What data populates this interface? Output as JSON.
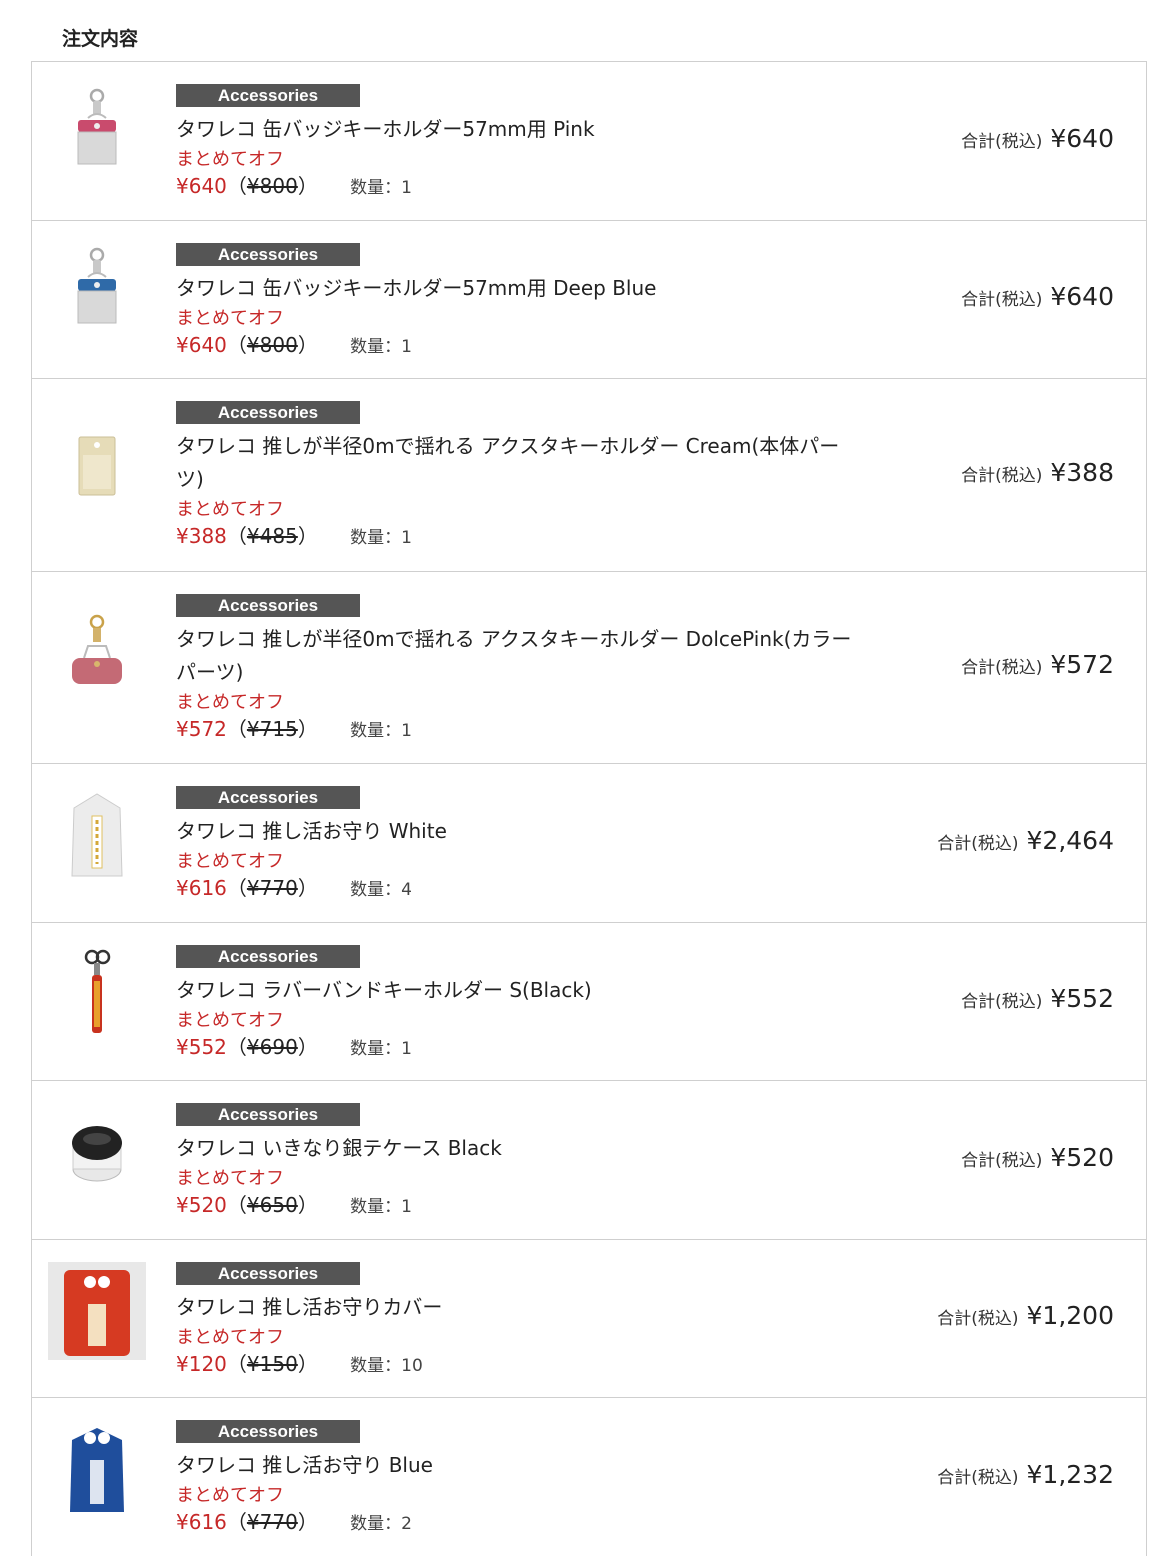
{
  "page_title": "注文内容",
  "labels": {
    "discount": "まとめてオフ",
    "qty_prefix": "数量：",
    "total_label": "合計(税込)",
    "open_paren": "（",
    "close_paren": "）"
  },
  "items": [
    {
      "category": "Accessories",
      "name": "タワレコ 缶バッジキーホルダー57mm用 Pink",
      "sale_price": "¥640",
      "original_price": "¥800",
      "quantity": "1",
      "total": "¥640",
      "thumb_color": "#c94b6d",
      "thumb": "keychain-pink"
    },
    {
      "category": "Accessories",
      "name": "タワレコ 缶バッジキーホルダー57mm用 Deep Blue",
      "sale_price": "¥640",
      "original_price": "¥800",
      "quantity": "1",
      "total": "¥640",
      "thumb_color": "#2f6aa8",
      "thumb": "keychain-blue"
    },
    {
      "category": "Accessories",
      "name": "タワレコ 推しが半径0mで揺れる アクスタキーホルダー Cream(本体パーツ)",
      "sale_price": "¥388",
      "original_price": "¥485",
      "quantity": "1",
      "total": "¥388",
      "thumb_color": "#e6dcb8",
      "thumb": "acrylic-cream"
    },
    {
      "category": "Accessories",
      "name": "タワレコ 推しが半径0mで揺れる アクスタキーホルダー DolcePink(カラーパーツ)",
      "sale_price": "¥572",
      "original_price": "¥715",
      "quantity": "1",
      "total": "¥572",
      "thumb_color": "#c46a75",
      "thumb": "acrylic-pink"
    },
    {
      "category": "Accessories",
      "name": "タワレコ 推し活お守り White",
      "sale_price": "¥616",
      "original_price": "¥770",
      "quantity": "4",
      "total": "¥2,464",
      "thumb_color": "#ececec",
      "thumb": "omamori-white"
    },
    {
      "category": "Accessories",
      "name": "タワレコ ラバーバンドキーホルダー S(Black)",
      "sale_price": "¥552",
      "original_price": "¥690",
      "quantity": "1",
      "total": "¥552",
      "thumb_color": "#c8321e",
      "thumb": "rubber-band"
    },
    {
      "category": "Accessories",
      "name": "タワレコ いきなり銀テケース Black",
      "sale_price": "¥520",
      "original_price": "¥650",
      "quantity": "1",
      "total": "¥520",
      "thumb_color": "#222222",
      "thumb": "case-black"
    },
    {
      "category": "Accessories",
      "name": "タワレコ 推し活お守りカバー",
      "sale_price": "¥120",
      "original_price": "¥150",
      "quantity": "10",
      "total": "¥1,200",
      "thumb_color": "#d63a22",
      "thumb": "omamori-cover"
    },
    {
      "category": "Accessories",
      "name": "タワレコ 推し活お守り Blue",
      "sale_price": "¥616",
      "original_price": "¥770",
      "quantity": "2",
      "total": "¥1,232",
      "thumb_color": "#1f4e9c",
      "thumb": "omamori-blue"
    }
  ]
}
